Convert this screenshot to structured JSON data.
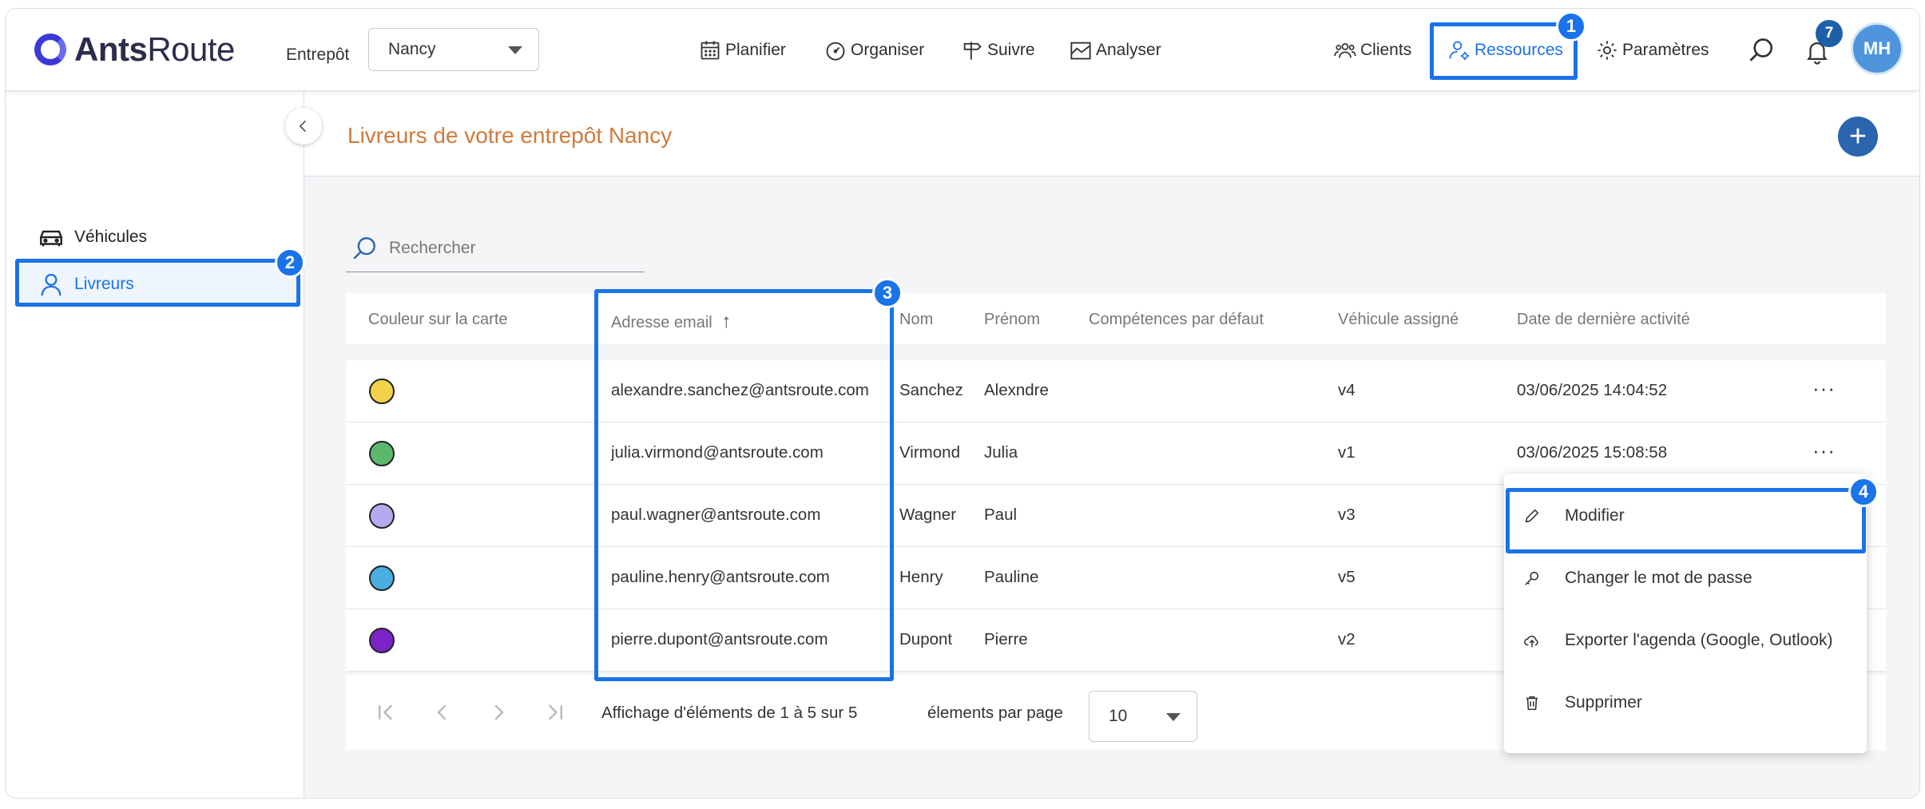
{
  "app": {
    "logo_bold": "Ants",
    "logo_light": "Route"
  },
  "header": {
    "warehouse_label": "Entrepôt",
    "warehouse_value": "Nancy",
    "nav": [
      {
        "label": "Planifier",
        "icon": "calendar-icon"
      },
      {
        "label": "Organiser",
        "icon": "gauge-icon"
      },
      {
        "label": "Suivre",
        "icon": "signpost-icon"
      },
      {
        "label": "Analyser",
        "icon": "chart-area-icon"
      }
    ],
    "right_nav": [
      {
        "label": "Clients",
        "icon": "users-icon"
      },
      {
        "label": "Ressources",
        "icon": "user-gear-icon",
        "active": true
      },
      {
        "label": "Paramètres",
        "icon": "gear-icon"
      }
    ],
    "notifications_count": "7",
    "user_initials": "MH"
  },
  "sidebar": {
    "items": [
      {
        "label": "Véhicules",
        "icon": "car-icon"
      },
      {
        "label": "Livreurs",
        "icon": "user-icon",
        "active": true
      }
    ]
  },
  "page": {
    "title": "Livreurs de votre entrepôt Nancy",
    "add_label": "+"
  },
  "search": {
    "placeholder": "Rechercher"
  },
  "table": {
    "columns": [
      "Couleur sur la carte",
      "Adresse email",
      "Nom",
      "Prénom",
      "Compétences par défaut",
      "Véhicule assigné",
      "Date de dernière activité"
    ],
    "sort_indicator": "↑",
    "rows": [
      {
        "color": "#f2d24a",
        "email": "alexandre.sanchez@antsroute.com",
        "nom": "Sanchez",
        "prenom": "Alexndre",
        "competences": "",
        "vehicule": "v4",
        "date": "03/06/2025 14:04:52",
        "more": "···"
      },
      {
        "color": "#5cb86a",
        "email": "julia.virmond@antsroute.com",
        "nom": "Virmond",
        "prenom": "Julia",
        "competences": "",
        "vehicule": "v1",
        "date": "03/06/2025 15:08:58",
        "more": "···"
      },
      {
        "color": "#b3aaf0",
        "email": "paul.wagner@antsroute.com",
        "nom": "Wagner",
        "prenom": "Paul",
        "competences": "",
        "vehicule": "v3",
        "date": "",
        "more": ""
      },
      {
        "color": "#4aaee0",
        "email": "pauline.henry@antsroute.com",
        "nom": "Henry",
        "prenom": "Pauline",
        "competences": "",
        "vehicule": "v5",
        "date": "",
        "more": ""
      },
      {
        "color": "#7a24c8",
        "email": "pierre.dupont@antsroute.com",
        "nom": "Dupont",
        "prenom": "Pierre",
        "competences": "",
        "vehicule": "v2",
        "date": "",
        "more": ""
      }
    ]
  },
  "pagination": {
    "summary": "Affichage d'éléments de 1 à 5 sur 5",
    "per_page_label": "élements par page",
    "per_page_value": "10"
  },
  "context_menu": {
    "items": [
      {
        "label": "Modifier",
        "icon": "pencil-icon"
      },
      {
        "label": "Changer le mot de passe",
        "icon": "key-icon"
      },
      {
        "label": "Exporter l'agenda (Google, Outlook)",
        "icon": "cloud-upload-icon"
      },
      {
        "label": "Supprimer",
        "icon": "trash-icon"
      }
    ]
  },
  "annotations": [
    "1",
    "2",
    "3",
    "4"
  ],
  "colors": {
    "accent": "#1a73e8",
    "title": "#d07a3a",
    "primary_button": "#2a65ad"
  }
}
